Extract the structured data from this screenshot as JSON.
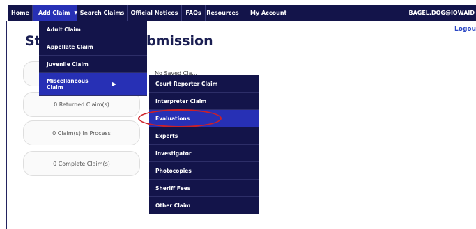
{
  "nav": {
    "home": "Home",
    "add_claim": "Add Claim",
    "search_claims": "Search Claims",
    "official_notices": "Official Notices",
    "faqs": "FAQs",
    "resources": "Resources",
    "my_account": "My Account",
    "user": "BAGEL.DOG@IOWAID"
  },
  "logout": "Logou",
  "page_title": "Sta                      er Online Submission",
  "sub_label": "No Saved Cla...",
  "status_cards": [
    "",
    "0 Returned Claim(s)",
    "0 Claim(s) In Process",
    "0 Complete Claim(s)"
  ],
  "add_claim_menu": [
    "Adult Claim",
    "Appellate Claim",
    "Juvenile Claim",
    "Miscellaneous Claim"
  ],
  "misc_submenu": [
    "Court Reporter Claim",
    "Interpreter Claim",
    "Evaluations",
    "Experts",
    "Investigator",
    "Photocopies",
    "Sheriff Fees",
    "Other Claim"
  ],
  "colors": {
    "nav_bg": "#13144a",
    "active_bg": "#2730b5",
    "annotation": "#cc2028",
    "title": "#1a1e52"
  }
}
